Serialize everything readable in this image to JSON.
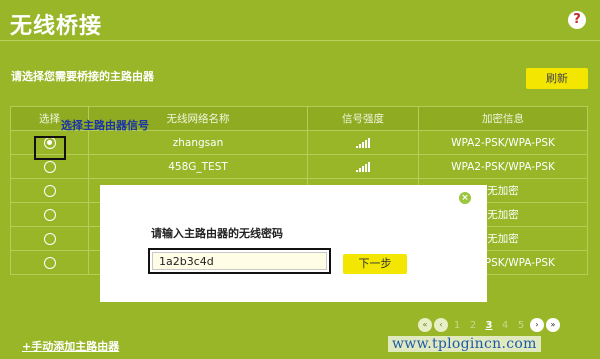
{
  "header": {
    "title": "无线桥接",
    "help": "?"
  },
  "prompt": "请选择您需要桥接的主路由器",
  "refresh_label": "刷新",
  "table": {
    "headers": [
      "选择",
      "无线网络名称",
      "信号强度",
      "加密信息"
    ],
    "rows": [
      {
        "selected": true,
        "ssid": "zhangsan",
        "signal": 5,
        "encryption": "WPA2-PSK/WPA-PSK"
      },
      {
        "selected": false,
        "ssid": "458G_TEST",
        "signal": 5,
        "encryption": "WPA2-PSK/WPA-PSK"
      },
      {
        "selected": false,
        "ssid": "",
        "signal": 0,
        "encryption": "无加密"
      },
      {
        "selected": false,
        "ssid": "",
        "signal": 0,
        "encryption": "无加密"
      },
      {
        "selected": false,
        "ssid": "",
        "signal": 0,
        "encryption": "无加密"
      },
      {
        "selected": false,
        "ssid": "",
        "signal": 0,
        "encryption": "WPA2-PSK/WPA-PSK"
      }
    ]
  },
  "annotation": "选择主路由器信号",
  "dialog": {
    "title": "请输入主路由器的无线密码",
    "password_value": "1a2b3c4d",
    "next_label": "下一步",
    "close": "×"
  },
  "add_link": "+手动添加主路由器",
  "pager": {
    "first": "«",
    "prev": "‹",
    "pages": [
      "1",
      "2",
      "3",
      "4",
      "5"
    ],
    "current": "3",
    "next": "›",
    "last": "»"
  },
  "watermark": "www.tplogincn.com"
}
